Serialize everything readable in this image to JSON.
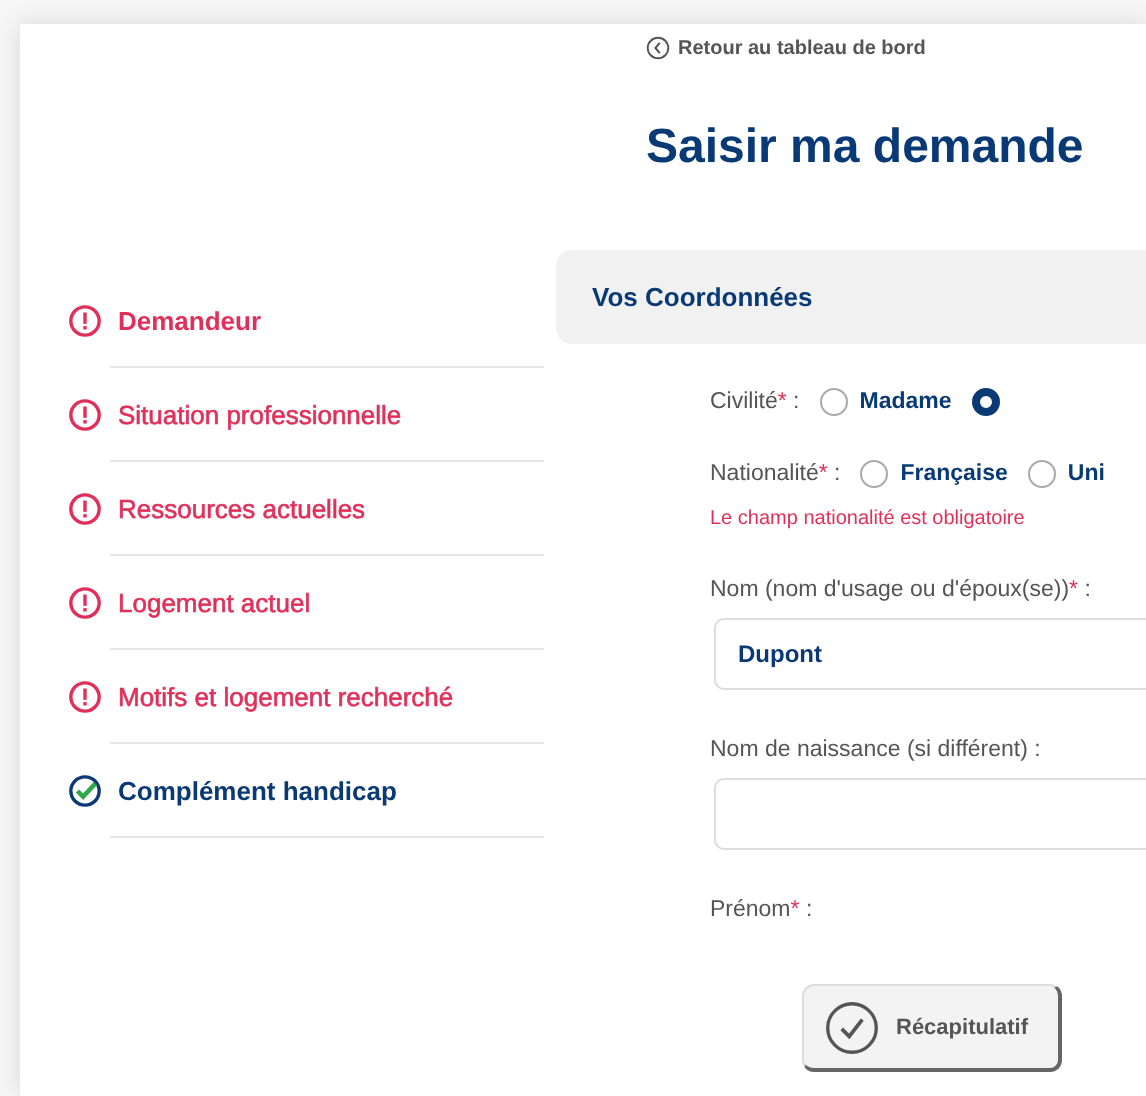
{
  "back_link": "Retour au tableau de bord",
  "title": "Saisir ma demande",
  "steps": [
    {
      "label": "Demandeur",
      "complete": false
    },
    {
      "label": "Situation professionnelle",
      "complete": false
    },
    {
      "label": "Ressources actuelles",
      "complete": false
    },
    {
      "label": "Logement actuel",
      "complete": false
    },
    {
      "label": "Motifs et logement recherché",
      "complete": false
    },
    {
      "label": "Complément handicap",
      "complete": true
    }
  ],
  "section_title": "Vos Coordonnées",
  "radio_groups": [
    {
      "label": "Civilité",
      "asterisk": "*",
      "suffix": ":",
      "options": [
        {
          "label": "Madame",
          "selected": false
        },
        {
          "selected": true
        }
      ]
    },
    {
      "label": "Nationalité",
      "asterisk": "*",
      "suffix": ":",
      "options": [
        {
          "label": "Française",
          "selected": false
        },
        {
          "label": "Uni",
          "selected": false
        }
      ],
      "error": "Le champ nationalité est obligatoire"
    }
  ],
  "fields": [
    {
      "label": "Nom (nom d'usage ou d'époux(se))",
      "asterisk": "*",
      "suffix": ":",
      "value": "Dupont"
    },
    {
      "label": "Nom de naissance (si différent)",
      "suffix": ":"
    }
  ],
  "next_label": {
    "label": "Prénom",
    "asterisk": "*",
    "suffix": ":"
  },
  "summary_button": "Récapitulatif"
}
